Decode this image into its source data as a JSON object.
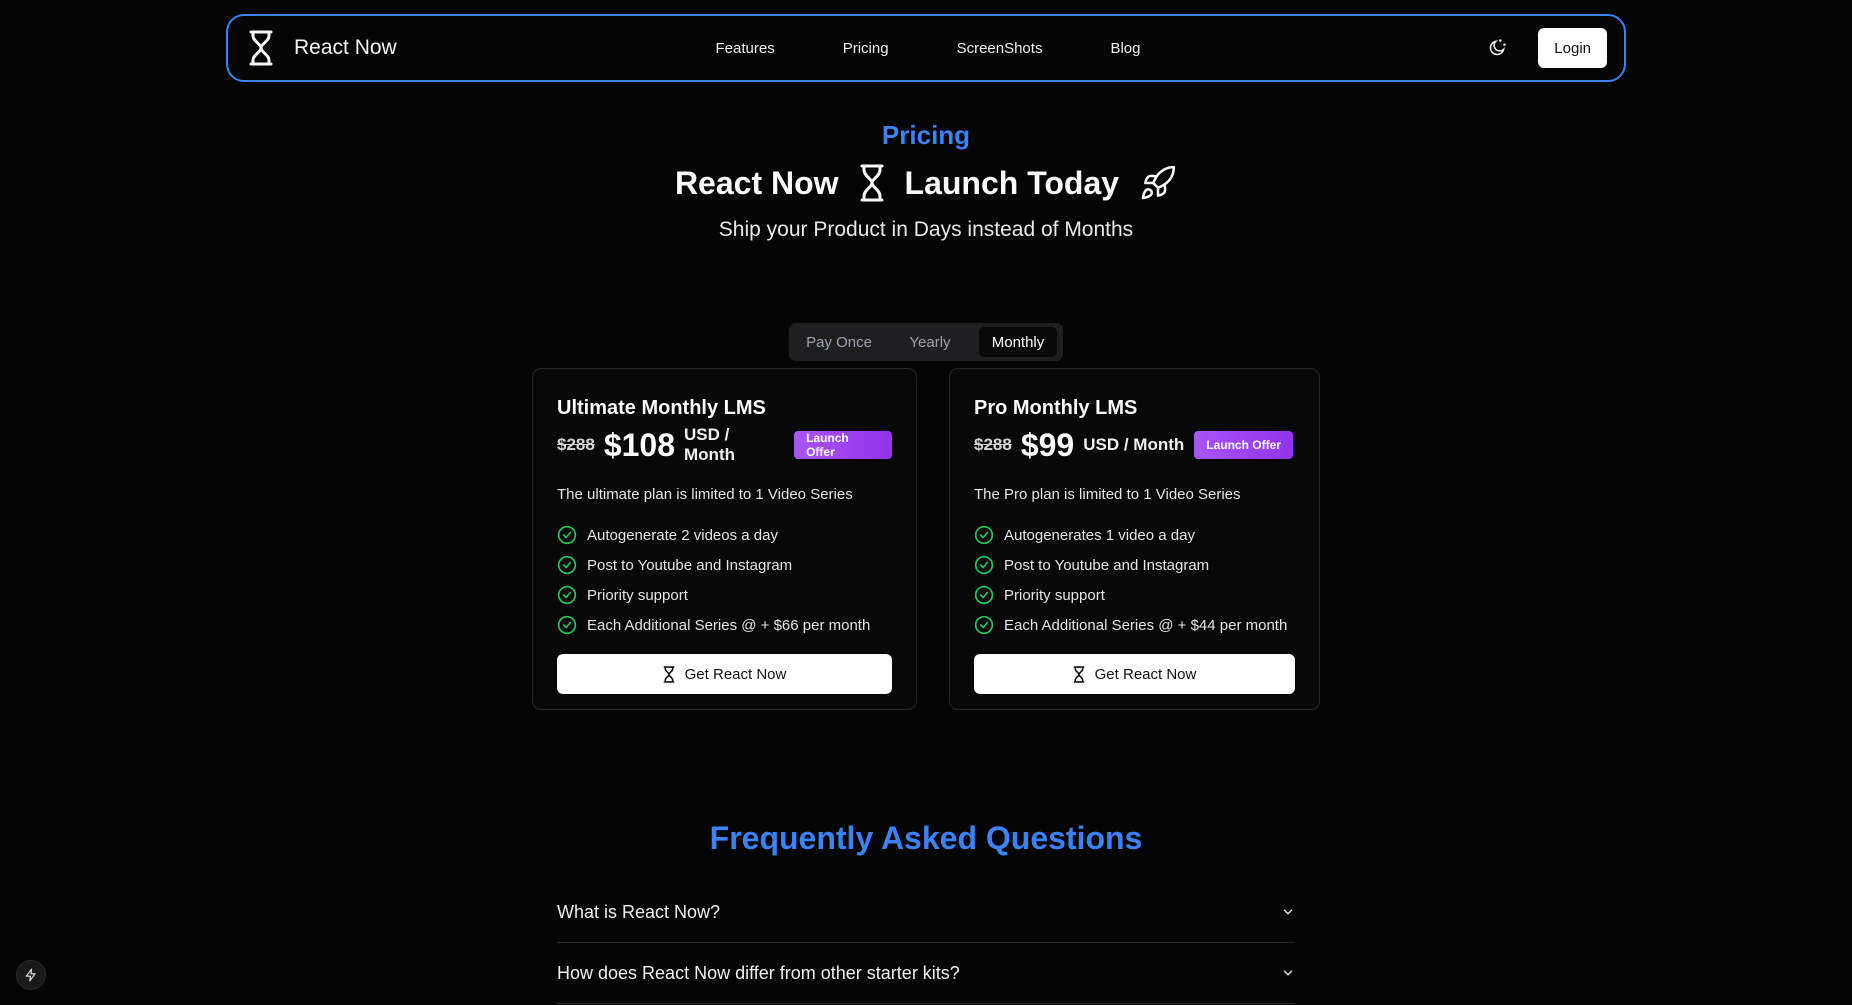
{
  "nav": {
    "brand": "React Now",
    "brand_icon": "hourglass-icon",
    "links": [
      "Features",
      "Pricing",
      "ScreenShots",
      "Blog"
    ],
    "theme_icon": "moon-sun-icon",
    "login_label": "Login"
  },
  "hero": {
    "eyebrow": "Pricing",
    "title_left": "React Now",
    "title_right": "Launch Today",
    "subtitle": "Ship your Product in Days instead of Months"
  },
  "billing": {
    "options": [
      "Pay Once",
      "Yearly",
      "Monthly"
    ],
    "selected": "Monthly"
  },
  "plans": [
    {
      "name": "Ultimate Monthly LMS",
      "old_price": "$288",
      "price": "$108",
      "period": "USD / Month",
      "badge": "Launch Offer",
      "description": "The ultimate plan is limited to 1 Video Series",
      "features": [
        "Autogenerate 2 videos a day",
        "Post to Youtube and Instagram",
        "Priority support",
        "Each Additional Series @ + $66 per month"
      ],
      "cta": "Get React Now"
    },
    {
      "name": "Pro Monthly LMS",
      "old_price": "$288",
      "price": "$99",
      "period": "USD / Month",
      "badge": "Launch Offer",
      "description": "The Pro plan is limited to 1 Video Series",
      "features": [
        "Autogenerates 1 video a day",
        "Post to Youtube and Instagram",
        "Priority support",
        "Each Additional Series @ + $44 per month"
      ],
      "cta": "Get React Now"
    }
  ],
  "faq": {
    "title": "Frequently Asked Questions",
    "items": [
      "What is React Now?",
      "How does React Now differ from other starter kits?"
    ]
  },
  "colors": {
    "accent": "#3b82f6",
    "badge": "#9333ea",
    "check": "#22c55e",
    "background": "#050505"
  }
}
